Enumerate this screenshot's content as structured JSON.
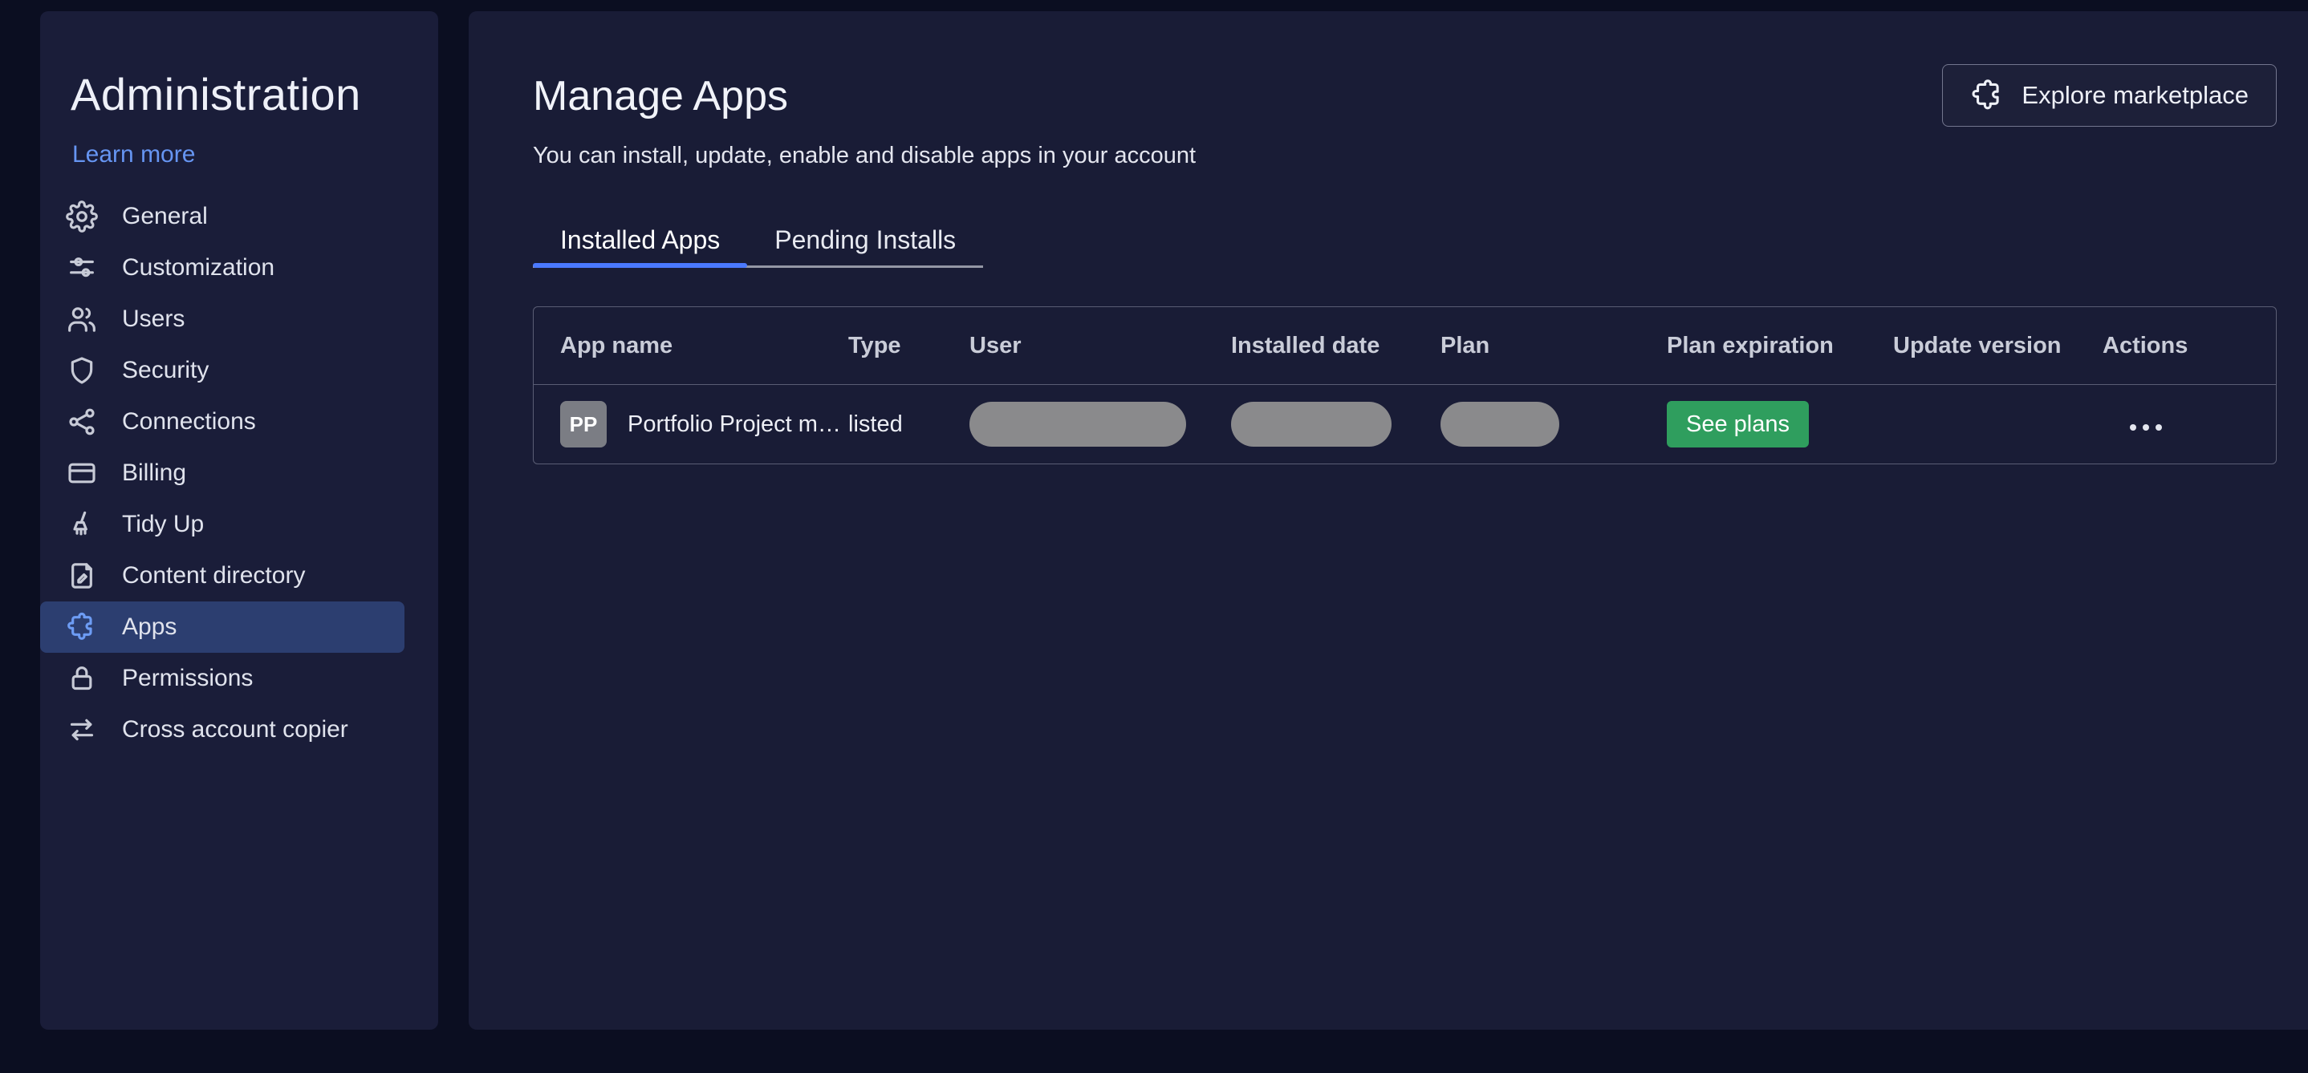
{
  "colors": {
    "accent_blue": "#4b79ff",
    "link_blue": "#6695f2",
    "selected_item_bg": "#2c3e70",
    "success_green": "#2f9e5e",
    "redacted_gray": "#8a8a8c"
  },
  "sidebar": {
    "title": "Administration",
    "learn_more_link": "Learn more",
    "items": [
      {
        "label": "General",
        "icon": "gear",
        "selected": false
      },
      {
        "label": "Customization",
        "icon": "sliders",
        "selected": false
      },
      {
        "label": "Users",
        "icon": "users",
        "selected": false
      },
      {
        "label": "Security",
        "icon": "shield",
        "selected": false
      },
      {
        "label": "Connections",
        "icon": "share-nodes",
        "selected": false
      },
      {
        "label": "Billing",
        "icon": "credit-card",
        "selected": false
      },
      {
        "label": "Tidy Up",
        "icon": "broom",
        "selected": false
      },
      {
        "label": "Content directory",
        "icon": "document-pencil",
        "selected": false
      },
      {
        "label": "Apps",
        "icon": "puzzle",
        "selected": true
      },
      {
        "label": "Permissions",
        "icon": "lock",
        "selected": false
      },
      {
        "label": "Cross account copier",
        "icon": "transfer-arrows",
        "selected": false
      }
    ]
  },
  "header": {
    "title": "Manage Apps",
    "subtitle": "You can install, update, enable and disable apps in your account",
    "explore_marketplace_label": "Explore marketplace",
    "explore_marketplace_icon": "puzzle"
  },
  "tabs": [
    {
      "label": "Installed Apps",
      "active": true
    },
    {
      "label": "Pending Installs",
      "active": false
    }
  ],
  "apps_table": {
    "headers": [
      "App name",
      "Type",
      "User",
      "Installed date",
      "Plan",
      "Plan expiration",
      "Update version",
      "Actions"
    ],
    "hidden_value_fields": [
      "user",
      "installed_date",
      "plan"
    ],
    "rows": [
      {
        "avatar_initials": "PP",
        "app_name": "Portfolio Project ma…",
        "type": "listed",
        "plan_expiration_action": "See plans",
        "update_version": "",
        "actions_icon": "more-options"
      }
    ]
  }
}
